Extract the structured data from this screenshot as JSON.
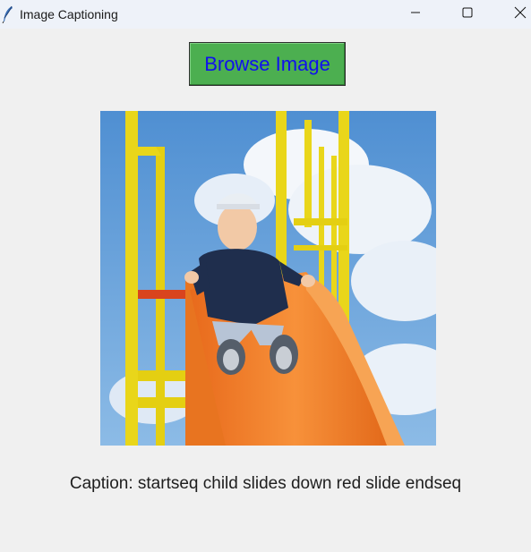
{
  "window": {
    "title": "Image Captioning",
    "app_icon": "feather-icon",
    "controls": [
      "minimize-icon",
      "maximize-icon",
      "close-icon"
    ]
  },
  "toolbar": {
    "browse_label": "Browse Image",
    "browse_bg": "#4caf50",
    "browse_text_color": "#1010ee"
  },
  "image": {
    "subject": "child-on-orange-slide-photo"
  },
  "caption": {
    "text": "Caption: startseq child slides down red slide endseq"
  }
}
